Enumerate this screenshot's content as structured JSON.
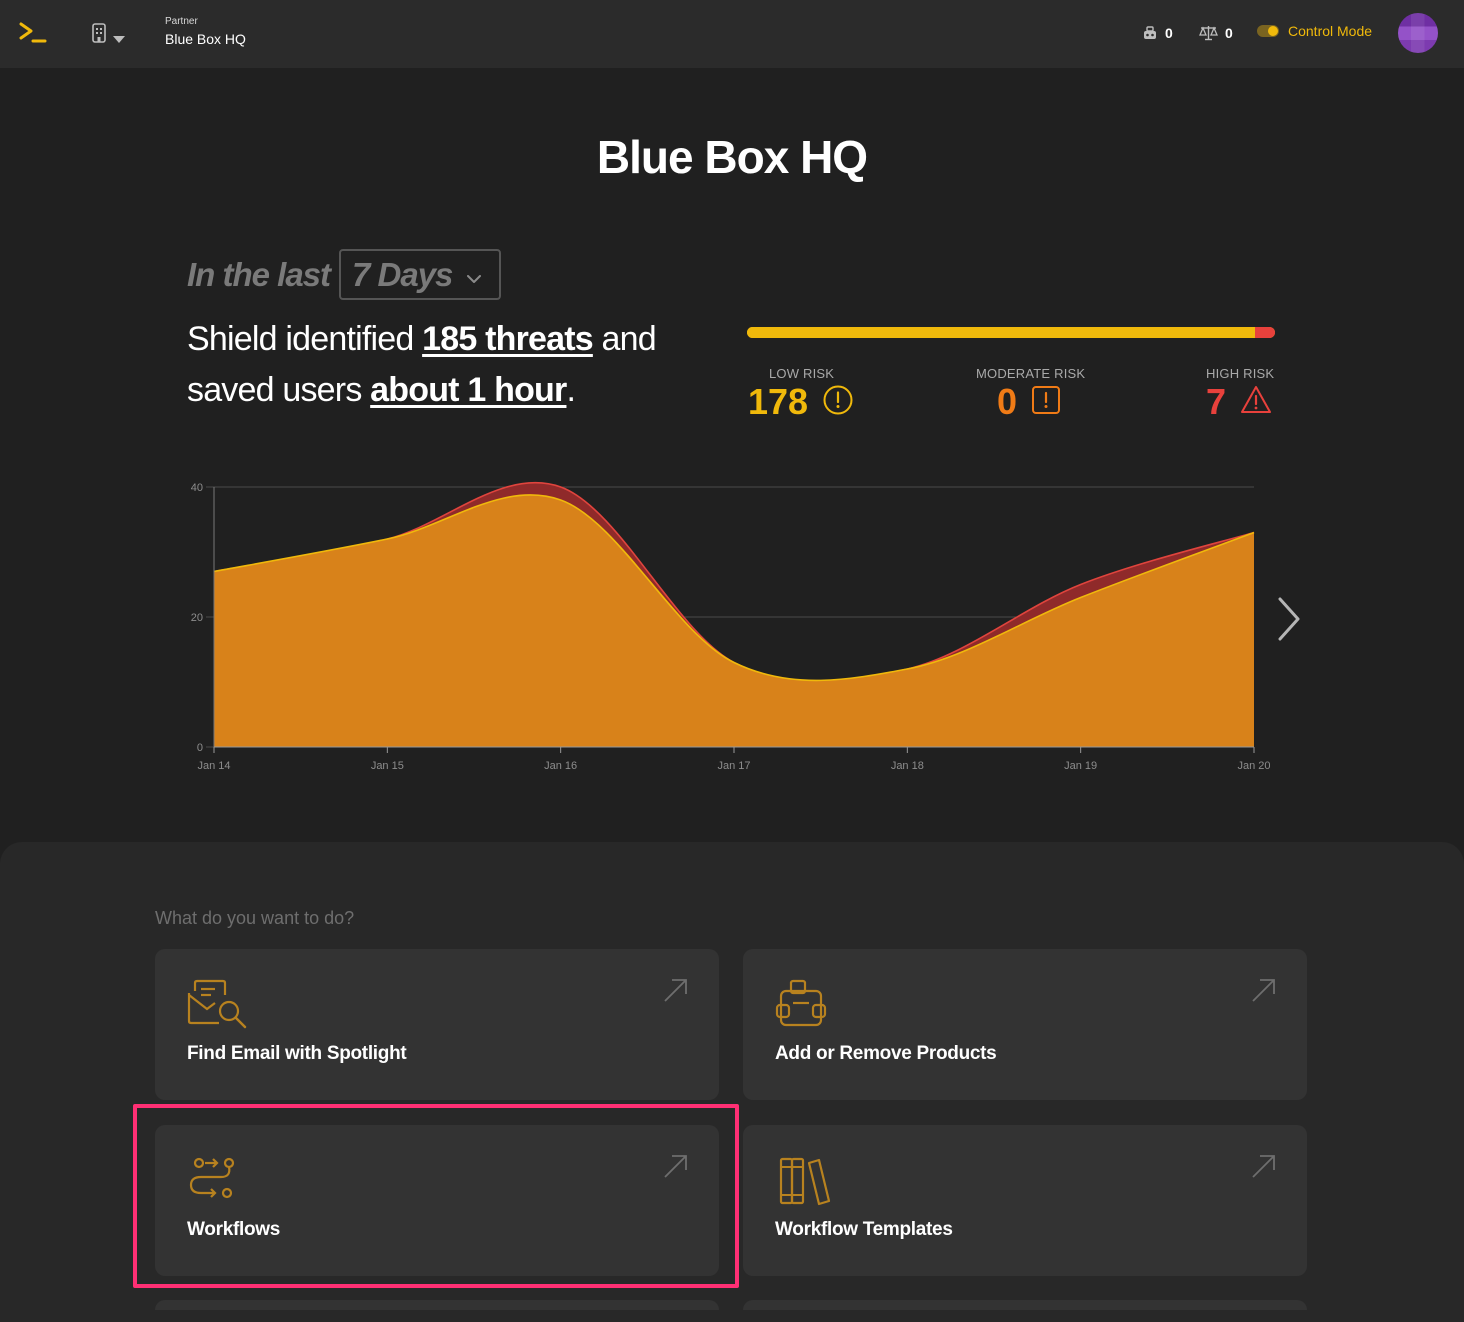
{
  "header": {
    "logo_icon": "terminal-prompt-icon",
    "org_switcher_icon": "building-icon",
    "partner_label": "Partner",
    "partner_name": "Blue Box HQ",
    "counter_one": {
      "icon": "robot-icon",
      "value": "0"
    },
    "counter_two": {
      "icon": "scales-icon",
      "value": "0"
    },
    "control_mode_label": "Control Mode",
    "control_mode_on": true,
    "avatar": "user-avatar"
  },
  "hero": {
    "title": "Blue Box HQ",
    "period_prefix": "In the last",
    "period_value": "7 Days",
    "summary_part1": "Shield identified ",
    "summary_threats": "185 threats",
    "summary_part2": " and saved users ",
    "summary_time": "about 1 hour",
    "summary_end": "."
  },
  "risk": {
    "bar": {
      "low": 178,
      "moderate": 0,
      "high": 7
    },
    "low": {
      "label": "LOW RISK",
      "value": "178",
      "color": "#f0b90b",
      "icon": "alert-circle-icon"
    },
    "moderate": {
      "label": "MODERATE RISK",
      "value": "0",
      "color": "#f07b16",
      "icon": "alert-square-icon"
    },
    "high": {
      "label": "HIGH RISK",
      "value": "7",
      "color": "#e8413c",
      "icon": "alert-triangle-icon"
    }
  },
  "chart_data": {
    "type": "area",
    "x": [
      "Jan 14",
      "Jan 15",
      "Jan 16",
      "Jan 17",
      "Jan 18",
      "Jan 19",
      "Jan 20"
    ],
    "series": [
      {
        "values": [
          27,
          32,
          38,
          13,
          12,
          23,
          33
        ],
        "color": "#d8821a"
      },
      {
        "values": [
          27,
          32,
          40,
          13,
          12,
          25,
          33
        ],
        "color": "#8f2a2a"
      }
    ],
    "yticks": [
      "0",
      "20",
      "40"
    ],
    "ylim": [
      0,
      40
    ],
    "grid": true
  },
  "actions": {
    "title": "What do you want to do?",
    "cards": [
      {
        "label": "Find Email with Spotlight",
        "icon": "email-search-icon"
      },
      {
        "label": "Add or Remove Products",
        "icon": "package-icon"
      },
      {
        "label": "Workflows",
        "icon": "workflow-icon"
      },
      {
        "label": "Workflow Templates",
        "icon": "books-icon"
      }
    ]
  }
}
